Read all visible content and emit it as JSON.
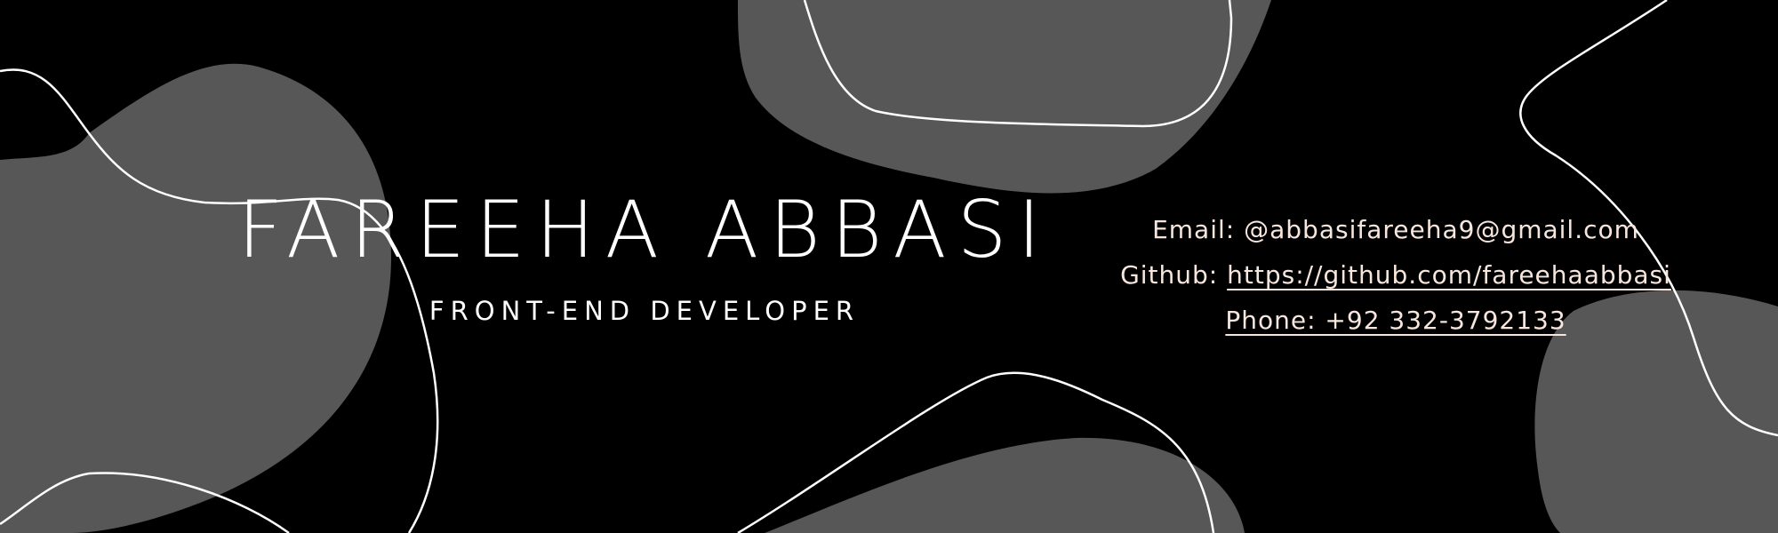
{
  "banner": {
    "colors": {
      "background": "#000000",
      "blob": "#575757",
      "text": "#ffffff",
      "contact_text": "#f6e6dd"
    },
    "name": "FAREEHA ABBASI",
    "title": "FRONT-END DEVELOPER"
  },
  "contact": {
    "email_label": "Email:",
    "email_value": "@abbasifareeha9@gmail.com",
    "github_label": "Github:",
    "github_url": "https://github.com/fareehaabbasi",
    "phone_text": "Phone:  +92 332-3792133"
  }
}
